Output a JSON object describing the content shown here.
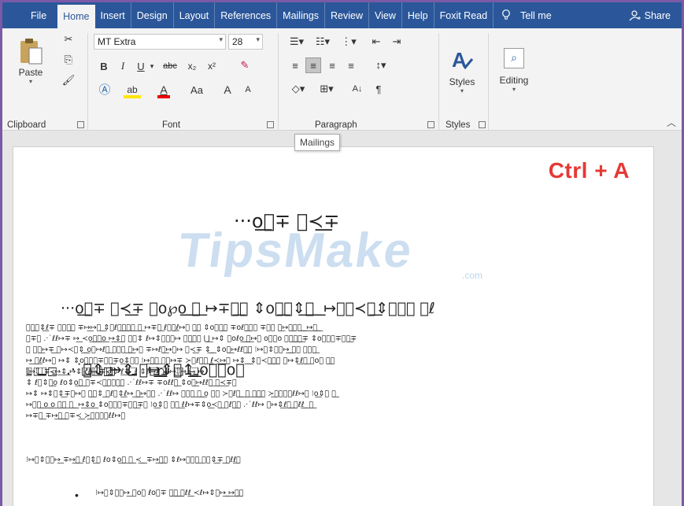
{
  "tabs": {
    "file": "File",
    "home": "Home",
    "insert": "Insert",
    "design": "Design",
    "layout": "Layout",
    "references": "References",
    "mailings": "Mailings",
    "review": "Review",
    "view": "View",
    "help": "Help",
    "foxit": "Foxit Read",
    "tell_me": "Tell me",
    "share": "Share"
  },
  "ribbon": {
    "clipboard": {
      "paste": "Paste",
      "label": "Clipboard"
    },
    "font": {
      "name": "MT Extra",
      "size": "28",
      "bold": "B",
      "italic": "I",
      "underline": "U",
      "strike": "abc",
      "subscript": "x₂",
      "superscript": "x²",
      "change_case": "Aa",
      "grow": "A",
      "shrink": "A",
      "label": "Font"
    },
    "paragraph": {
      "label": "Paragraph",
      "sort": "A↓",
      "pilcrow": "¶"
    },
    "styles": {
      "button": "Styles",
      "label": "Styles"
    },
    "editing": {
      "button": "Editing"
    }
  },
  "tooltip": "Mailings",
  "document": {
    "shortcut": "Ctrl + A",
    "watermark": "TipsMake",
    "watermark_sub": ".com",
    "title": "···ο͟⃞∓ ⃞≺͟∓",
    "heading_lines": [
      "···ο͟⃞∓ ⃞≺͟∓ ⃞ο℘ο͟ ͟⃞͟ ↦∓⃞͟⃞ ⇕ο⃞͟⃞⇕͟⃞͟ ͟ ↦⃞⃞≺⃞͟⇕⃞⃞⃞ ⃞ℓ",
      "⃞͟⃞ .·˙⃞⇕ ↦⇕ ⤐↦͟⇕⃞↥͟ ο⃞⃞ο⃞"
    ],
    "para1": [
      "⃞⃞͟⃞⇕͟ℓ∓ ⃞⃞⃞͟⃞ ∓↦͟↦⃞ ͟⇕⃞ℓ⃞͟⃞͟⃞͟⃞ ͟⃞͟ ↦∓⃞͟ ℓ⃞⃞͟ℓ↦⃞ ⃞͟⃞ ⇕ο⃞⃞͟⃞ ∓οℓ⃞͟⃞⃞ ∓⃞⃞ ⃞͟↦⃞͟⃞⃞͟ ͟ ͟↦͟⃞͟ ͟",
      "⃞∓⃞ .·˙ℓℓ↦∓ ↦͟ ≺ο͟⃞͟⃞͟ο͟ ↦͟⇕͟⃞ ⃞⃞⇕ ℓ↦⇕⃞⃞⃞↦ ⃞⃞͟⃞⃞ ⋃͟ ↦⇕ ⃞οℓο͟ ͟⃞͟↦⃞ ο⃞⃞ο ⃞⃞͟⃞͟⃞͟∓ ⇕ο⃞⃞⃞∓⃞⃞͟∓",
      "⃞ ⃞⃞͟↦∓͟ ⃞↦≺⃞⇕͟ ͟ο⃞↦ℓ⃞͟ ⃞⃞⃞ ͟⃞͟↦⃞ ∓↦ℓ⃞͟↦⃞↦ ⃞≺͟∓ ⇕͟ ͟ ⇕ο⃞͟↦ℓℓ⃞͟⃞ ⁝↦⃞⇕⃞⃞↦͟ ͟⃞⃞ ⃞⃞⃞͟",
      "↦͟ ⃞͟ℓℓ↦⃞ ↦⇕ ⇕ο⃞⃞⃞∓⃞⃞͟∓ο͟⇕⃞⃞ ⁝↦͟⃞͟⃞͟ ⃞⃞↦∓ ≻⃞ℓ⃞͟⃞ ͟ℓ≺͟↦͟⃞ ↦⇕ ͟ ͟⇕⃞≺⃞͟⃞͟⃞ ⃞↦⇕͟ℓ⃞͟ ⃞ο⃞ ⃞͟⃞",
      "⫴⃞͟↦⇕⃞͟ ͟ ͟⃞∓≺⃞͟↦͟⇕͟ ↦⇕ ℓ⃞⃞͟ℓ↦⃞ ͟⃞∓≺⃞͟⃞ ⃞⃞⇕ ℓ͟⇕͟ ͟ ⃞⃞͟ℓ ⇕ℓ↦⃞⃞⃞͟⃞ ⋂⃞͟⃞⃞⃞͟ ℓ↦⇕⃞⃞⃞↦ ↦⃞͟⃞ ↦",
      "⇕ ℓ⃞⇕⃞͟ο ℓο⇕ο͟⃞͟ ⃞∓≺⃞͟⃞⃞⃞͟⃞ .·˙ℓℓ↦∓ ∓οℓℓ⃞͟ ⇕ο⃞͟↦ℓℓ⃞͟ ⃞͟≺͟∓⃞",
      "↦⇕ ↦⇕⃞⇕͟∓⃞↦⃞ ⃞͟⃞⇕ ͟⃞ℓ⃞⇕͟ℓ↦ ͟⃞͟↦⃞⃞ .·˙ℓℓ↦ ⃞⃞⃞͟ ⃞͟ ͟ο ⃞⃞ ≻⃞ℓ⃞͟ ͟ ⃞͟ ⃞͟⃞͟⃞ ≻͟⃞⃞⃞⃞ℓℓ↦⃞ ⁝ο͟⇕⃞ ⃞͟",
      "↦⃞⃞͟ ͟ο͟ ͟ο͟ ⃞͟⃞͟ ⃞͟ ͟ ↦͟⇕͟ο͟ ⇕ο⃞⃞⃞∓⃞⃞͟∓⃞ ⁝ο͟⇕⃞ ⃞⃞ ͟ℓℓ↦∓⇕ο͟≺⃞͟ ⃞ℓ⃞͟⃞ .·˙ℓℓ↦ ⃞↦⇕͟ℓ⃞͟ ͟⃞ℓℓ͟ ͟ ⃞͟",
      "↦∓⃞͟ ∓↦͟⃞͟ ͟⃞∓≺͟ ≻͟⃞⃞⃞⃞ℓℓ↦⃞"
    ],
    "para2": "⁝↦⃞⇕⃞⃞↦͟ ∓↦͟⃞͟ ℓ⃞⇕͟⃞ ℓο⇕ο͟⃞͟ ⃞͟ ≺͟ ͟ ∓↦͟⃞͟⃞ ⇕ℓ↦⃞⃞⃞͟ ⃞⃞⇕͟∓ ͟⃞ℓℓ͟⃞",
    "bullet": "•",
    "bullet_text": "⁝↦⃞⇕⃞⃞↦͟ ⃞ο⃞ ℓο⃞∓ ⃞͟⃞͟ ͟⃞ℓℓ͟ ≺ℓ↦⇕⃞↦͟ ͟↦͟⃞͟⃞"
  },
  "colors": {
    "accent": "#2b579a",
    "ribbon": "#f3f3f3",
    "shortcut": "#e53935",
    "border": "#7a5aa6"
  }
}
